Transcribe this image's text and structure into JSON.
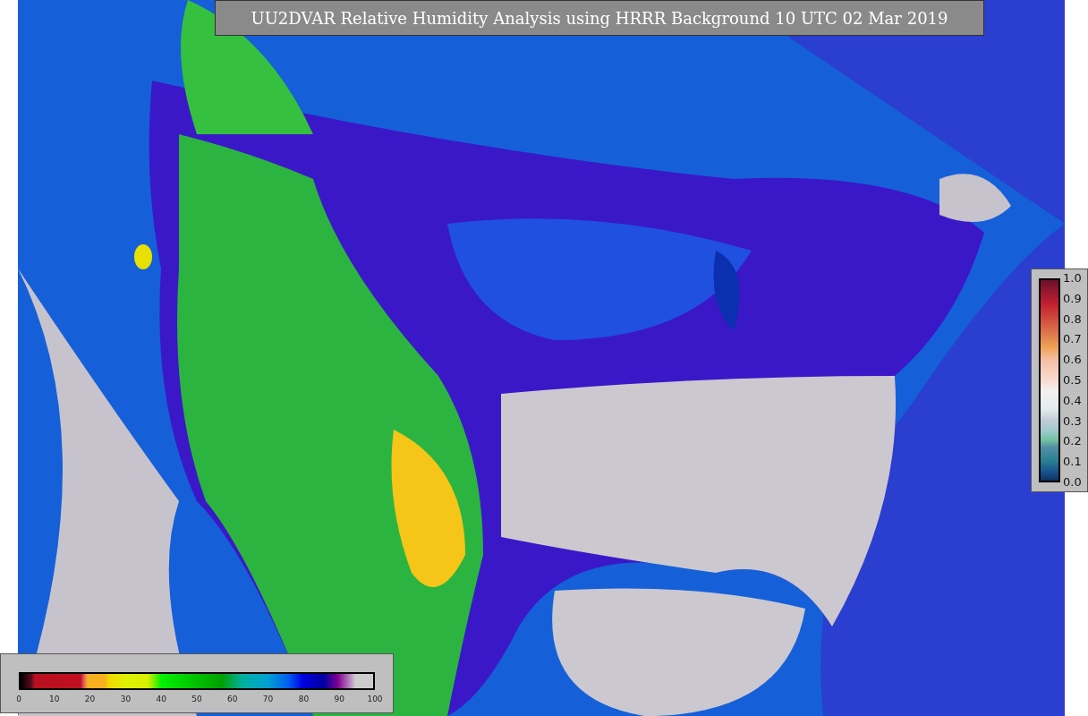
{
  "title": "UU2DVAR Relative Humidity Analysis using HRRR Background 10 UTC 02 Mar 2019",
  "humidity_colorbar": {
    "ticks": [
      "0",
      "10",
      "20",
      "30",
      "40",
      "50",
      "60",
      "70",
      "80",
      "90",
      "100"
    ]
  },
  "observation_colorbar": {
    "ticks": [
      "1.0",
      "0.9",
      "0.8",
      "0.7",
      "0.6",
      "0.5",
      "0.4",
      "0.3",
      "0.2",
      "0.1",
      "0.0"
    ]
  }
}
